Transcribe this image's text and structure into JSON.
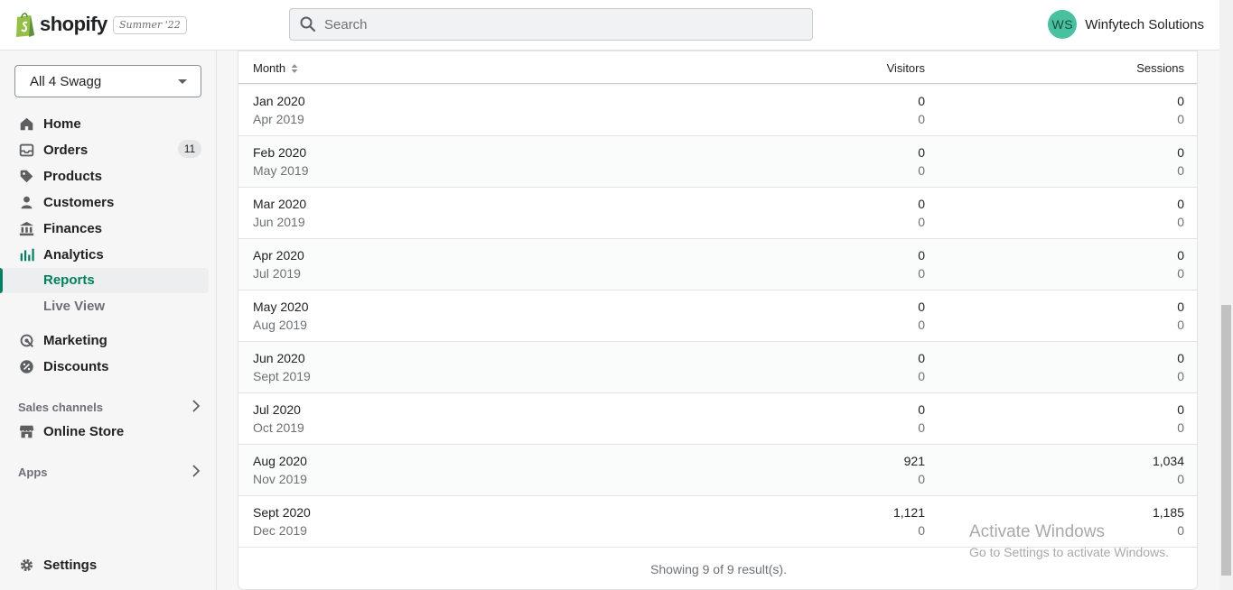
{
  "header": {
    "logo_text": "shopify",
    "edition": "Summer '22",
    "search_placeholder": "Search",
    "user_initials": "WS",
    "user_name": "Winfytech Solutions"
  },
  "sidebar": {
    "store_name": "All 4 Swagg",
    "nav": [
      {
        "label": "Home",
        "icon": "home-icon"
      },
      {
        "label": "Orders",
        "icon": "orders-icon",
        "badge": "11"
      },
      {
        "label": "Products",
        "icon": "tag-icon"
      },
      {
        "label": "Customers",
        "icon": "person-icon"
      },
      {
        "label": "Finances",
        "icon": "bank-icon"
      },
      {
        "label": "Analytics",
        "icon": "analytics-icon"
      }
    ],
    "analytics_sub": [
      {
        "label": "Reports",
        "active": true
      },
      {
        "label": "Live View",
        "active": false
      }
    ],
    "nav2": [
      {
        "label": "Marketing",
        "icon": "marketing-icon"
      },
      {
        "label": "Discounts",
        "icon": "discount-icon"
      }
    ],
    "sales_channels_heading": "Sales channels",
    "online_store_label": "Online Store",
    "apps_heading": "Apps",
    "settings_label": "Settings"
  },
  "table": {
    "columns": {
      "month": "Month",
      "visitors": "Visitors",
      "sessions": "Sessions"
    },
    "rows": [
      {
        "month": "Jan 2020",
        "month_prev": "Apr 2019",
        "visitors": "0",
        "visitors_prev": "0",
        "sessions": "0",
        "sessions_prev": "0"
      },
      {
        "month": "Feb 2020",
        "month_prev": "May 2019",
        "visitors": "0",
        "visitors_prev": "0",
        "sessions": "0",
        "sessions_prev": "0"
      },
      {
        "month": "Mar 2020",
        "month_prev": "Jun 2019",
        "visitors": "0",
        "visitors_prev": "0",
        "sessions": "0",
        "sessions_prev": "0"
      },
      {
        "month": "Apr 2020",
        "month_prev": "Jul 2019",
        "visitors": "0",
        "visitors_prev": "0",
        "sessions": "0",
        "sessions_prev": "0"
      },
      {
        "month": "May 2020",
        "month_prev": "Aug 2019",
        "visitors": "0",
        "visitors_prev": "0",
        "sessions": "0",
        "sessions_prev": "0"
      },
      {
        "month": "Jun 2020",
        "month_prev": "Sept 2019",
        "visitors": "0",
        "visitors_prev": "0",
        "sessions": "0",
        "sessions_prev": "0"
      },
      {
        "month": "Jul 2020",
        "month_prev": "Oct 2019",
        "visitors": "0",
        "visitors_prev": "0",
        "sessions": "0",
        "sessions_prev": "0"
      },
      {
        "month": "Aug 2020",
        "month_prev": "Nov 2019",
        "visitors": "921",
        "visitors_prev": "0",
        "sessions": "1,034",
        "sessions_prev": "0"
      },
      {
        "month": "Sept 2020",
        "month_prev": "Dec 2019",
        "visitors": "1,121",
        "visitors_prev": "0",
        "sessions": "1,185",
        "sessions_prev": "0"
      }
    ],
    "footer": "Showing 9 of 9 result(s)."
  },
  "watermark": {
    "title": "Activate Windows",
    "subtitle": "Go to Settings to activate Windows."
  },
  "colors": {
    "brand_green": "#008060",
    "avatar_bg": "#47c1a0"
  }
}
